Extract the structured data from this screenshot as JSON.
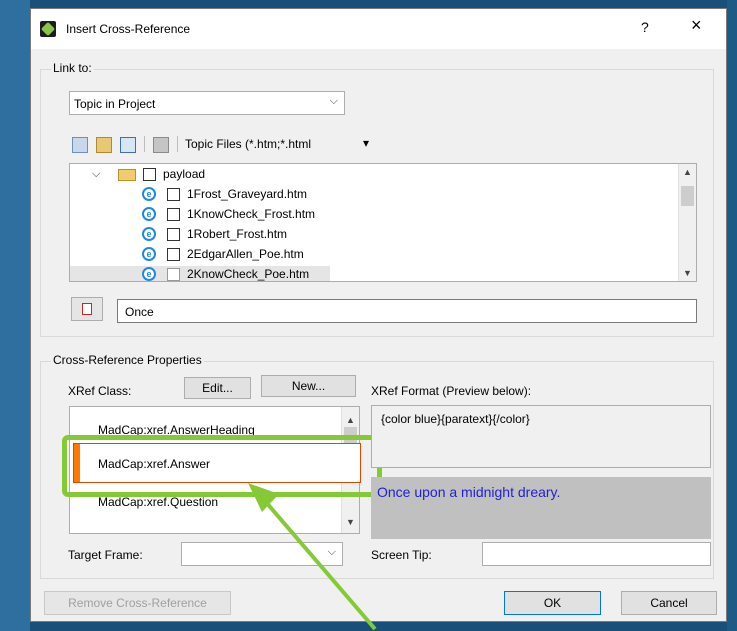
{
  "dialog": {
    "title": "Insert Cross-Reference",
    "help_label": "?",
    "close_label": "×"
  },
  "link_to": {
    "group_label": "Link to:",
    "selected": "Topic in Project",
    "filter_label": "Topic Files (*.htm;*.html",
    "filter_arrow": "▾"
  },
  "tree": {
    "folder": "payload",
    "items": [
      "1Frost_Graveyard.htm",
      "1KnowCheck_Frost.htm",
      "1Robert_Frost.htm",
      "2EdgarAllen_Poe.htm",
      "2KnowCheck_Poe.htm"
    ]
  },
  "text_field": {
    "value": "Once"
  },
  "properties": {
    "group_label": "Cross-Reference Properties",
    "xref_class_label": "XRef Class:",
    "edit_button": "Edit...",
    "new_button": "New...",
    "xref_format_label": "XRef Format (Preview below):",
    "classes": [
      "MadCap:xref.AnswerHeading",
      "MadCap:xref.Answer",
      "MadCap:xref.Question"
    ],
    "selected_class": "MadCap:xref.Answer",
    "format_text": "{color blue}{paratext}{/color}",
    "preview_text": "Once upon a midnight dreary.",
    "target_frame_label": "Target Frame:",
    "screen_tip_label": "Screen Tip:"
  },
  "footer": {
    "remove_button": "Remove Cross-Reference",
    "ok_button": "OK",
    "cancel_button": "Cancel"
  },
  "colors": {
    "desktop": "#1a4f7a",
    "dialog": "#f0f0f0",
    "highlight": "#86c936",
    "selection_bar": "#ff7a00",
    "preview_text": "#1f1fd8",
    "preview_bg": "#c0c0c0"
  },
  "icons": {
    "tree_expand": "chevron-down-icon",
    "file": "ie-document-icon",
    "folder": "folder-icon",
    "annotation_arrow": "arrow-icon"
  }
}
